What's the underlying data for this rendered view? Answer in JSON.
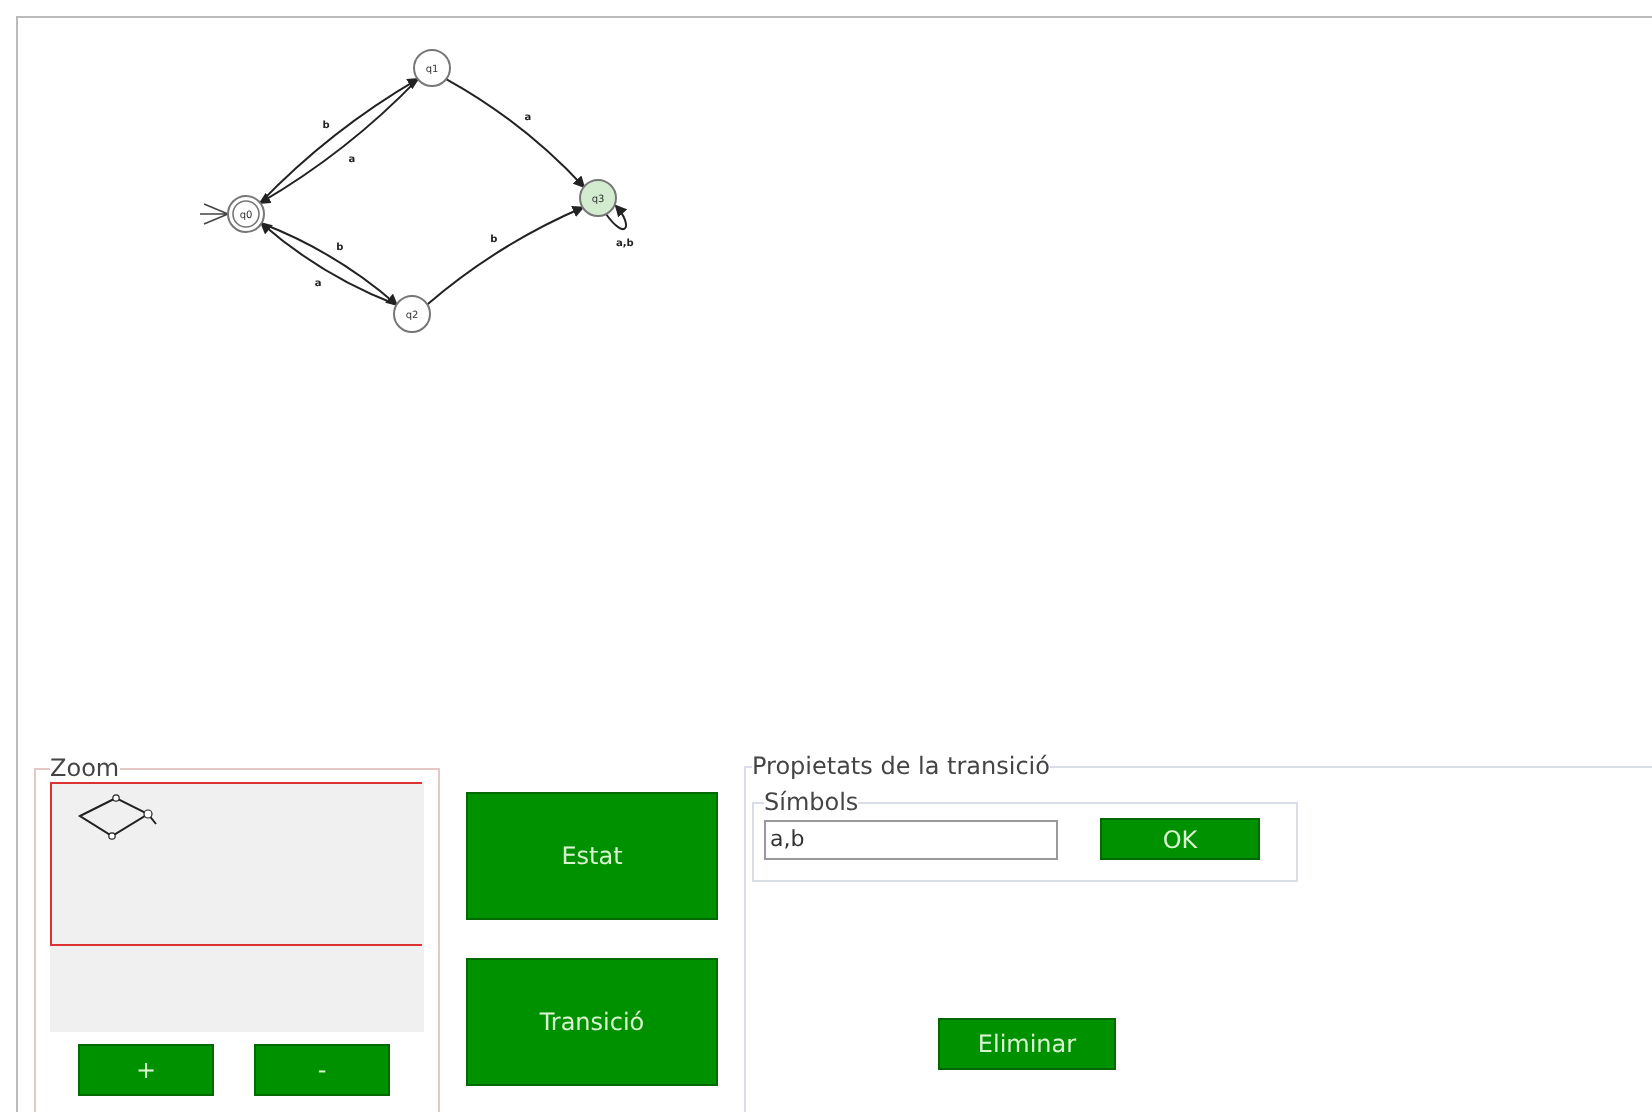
{
  "diagram": {
    "states": [
      {
        "label": "q0",
        "initial": true,
        "accepting": true,
        "highlighted": false
      },
      {
        "label": "q1",
        "initial": false,
        "accepting": false,
        "highlighted": false
      },
      {
        "label": "q2",
        "initial": false,
        "accepting": false,
        "highlighted": false
      },
      {
        "label": "q3",
        "initial": false,
        "accepting": false,
        "highlighted": true
      }
    ],
    "transitions": [
      {
        "label": "b"
      },
      {
        "label": "a"
      },
      {
        "label": "a"
      },
      {
        "label": "a"
      },
      {
        "label": "b"
      },
      {
        "label": "b"
      },
      {
        "label": "a,b"
      }
    ]
  },
  "zoom": {
    "title": "Zoom",
    "buttons": [
      "+",
      "-"
    ]
  },
  "tools": [
    "Estat",
    "Transició"
  ],
  "properties": {
    "title": "Propietats de la transició",
    "symbols": {
      "title": "Símbols",
      "value": "a,b",
      "button": "OK"
    },
    "delete_button": "Eliminar"
  }
}
